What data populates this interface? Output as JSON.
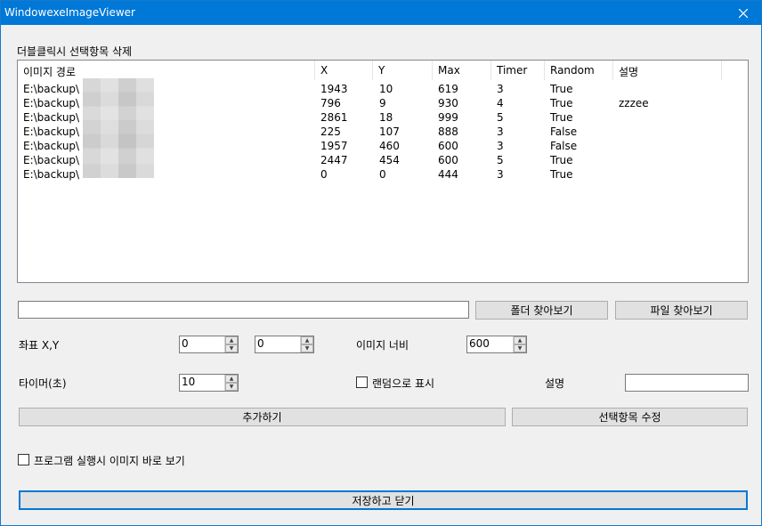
{
  "window": {
    "title": "WindowexeImageViewer",
    "close_glyph": "✕"
  },
  "list": {
    "caption": "더블클릭시 선택항목 삭제",
    "headers": [
      "이미지 경로",
      "X",
      "Y",
      "Max",
      "Timer",
      "Random",
      "설명"
    ],
    "rows": [
      {
        "path": "E:\\backup\\",
        "x": "1943",
        "y": "10",
        "max": "619",
        "timer": "3",
        "random": "True",
        "desc": ""
      },
      {
        "path": "E:\\backup\\",
        "x": "796",
        "y": "9",
        "max": "930",
        "timer": "4",
        "random": "True",
        "desc": "zzzee"
      },
      {
        "path": "E:\\backup\\",
        "x": "2861",
        "y": "18",
        "max": "999",
        "timer": "5",
        "random": "True",
        "desc": ""
      },
      {
        "path": "E:\\backup\\",
        "x": "225",
        "y": "107",
        "max": "888",
        "timer": "3",
        "random": "False",
        "desc": ""
      },
      {
        "path": "E:\\backup\\",
        "x": "1957",
        "y": "460",
        "max": "600",
        "timer": "3",
        "random": "False",
        "desc": ""
      },
      {
        "path": "E:\\backup\\",
        "x": "2447",
        "y": "454",
        "max": "600",
        "timer": "5",
        "random": "True",
        "desc": ""
      },
      {
        "path": "E:\\backup\\",
        "x": "0",
        "y": "0",
        "max": "444",
        "timer": "3",
        "random": "True",
        "desc": ""
      }
    ]
  },
  "path_input": {
    "value": ""
  },
  "buttons": {
    "browse_folder": "폴더 찾아보기",
    "browse_file": "파일 찾아보기",
    "add": "추가하기",
    "edit_selected": "선택항목 수정",
    "save_close": "저장하고 닫기"
  },
  "form": {
    "coord_label": "좌표 X,Y",
    "x_value": "0",
    "y_value": "0",
    "width_label": "이미지 너비",
    "width_value": "600",
    "timer_label": "타이머(초)",
    "timer_value": "10",
    "random_label": "랜덤으로 표시",
    "random_checked": false,
    "desc_label": "설명",
    "desc_value": ""
  },
  "startup": {
    "label": "프로그램 실행시 이미지 바로 보기",
    "checked": false
  },
  "colors": {
    "titlebar": "#0078d7",
    "button_face": "#e1e1e1",
    "default_button_border": "#0078d7"
  }
}
